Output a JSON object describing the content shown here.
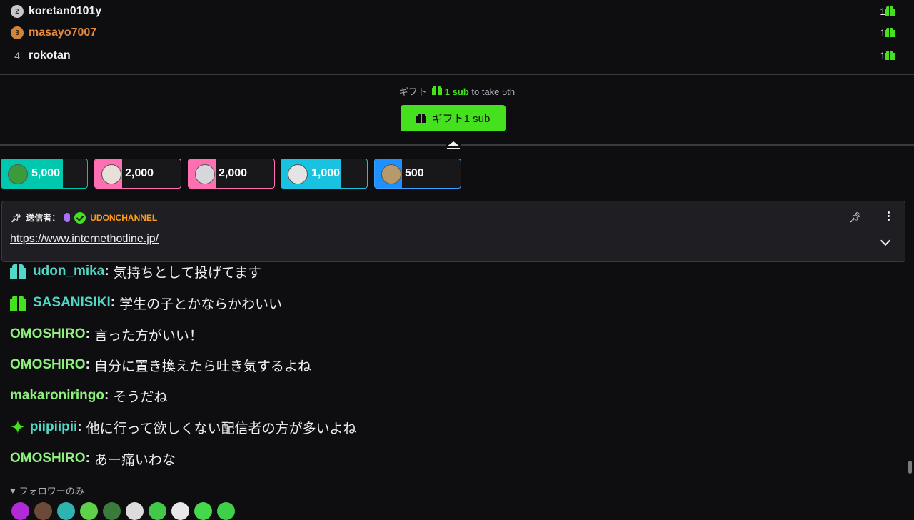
{
  "leaderboard": {
    "rows": [
      {
        "rank": "2",
        "name": "koretan0101y",
        "count": "1"
      },
      {
        "rank": "3",
        "name": "masayo7007",
        "count": "1"
      },
      {
        "rank": "4",
        "name": "rokotan",
        "count": "1"
      }
    ]
  },
  "gift_prompt": {
    "prefix": "ギフト",
    "sub": "1 sub",
    "suffix": "to take 5th",
    "button_label": "ギフト1 sub"
  },
  "hype_chips": [
    {
      "amount": "5,000",
      "fill_fraction": 0.72,
      "color": "#00c8af",
      "border": "#00c8af"
    },
    {
      "amount": "2,000",
      "fill_fraction": 0.32,
      "color": "#ff6fb1",
      "border": "#ff6fb1"
    },
    {
      "amount": "2,000",
      "fill_fraction": 0.32,
      "color": "#ff6fb1",
      "border": "#ff6fb1"
    },
    {
      "amount": "1,000",
      "fill_fraction": 0.7,
      "color": "#18c2e0",
      "border": "#18c2e0"
    },
    {
      "amount": "500",
      "fill_fraction": 0.32,
      "color": "#1e90ff",
      "border": "#3aa0ff"
    }
  ],
  "pinned": {
    "sender_label": "送信者：",
    "channel": "UDONCHANNEL",
    "link": "https://www.internethotline.jp/"
  },
  "chat": [
    {
      "badge": "gift-teal",
      "user": "udon_mika",
      "color": "#52d8c6",
      "text": "気持ちとして投げてます"
    },
    {
      "badge": "gift-green",
      "user": "SASANISIKI",
      "color": "#52d8c6",
      "text": "学生の子とかならかわいい"
    },
    {
      "badge": "",
      "user": "OMOSHIRO",
      "color": "#8ef07d",
      "text": "言った方がいい！"
    },
    {
      "badge": "",
      "user": "OMOSHIRO",
      "color": "#8ef07d",
      "text": "自分に置き換えたら吐き気するよね"
    },
    {
      "badge": "",
      "user": "makaroniringo",
      "color": "#8ef07d",
      "text": "そうだね"
    },
    {
      "badge": "sparkle",
      "user": "piipiipii",
      "color": "#52d8c6",
      "text": "他に行って欲しくない配信者の方が多いよね"
    },
    {
      "badge": "",
      "user": "OMOSHIRO",
      "color": "#8ef07d",
      "text": "あー痛いわな"
    }
  ],
  "follower_only": "フォロワーのみ",
  "icons": {
    "gift": "gift-icon",
    "pin": "pin-icon",
    "more": "more-vertical-icon",
    "chevron": "chevron-down-icon",
    "heart": "heart-icon",
    "collapse": "collapse-icon"
  },
  "colors": {
    "accent": "#45e01e",
    "background": "#0e0e10",
    "channel": "#ff9c1a"
  }
}
